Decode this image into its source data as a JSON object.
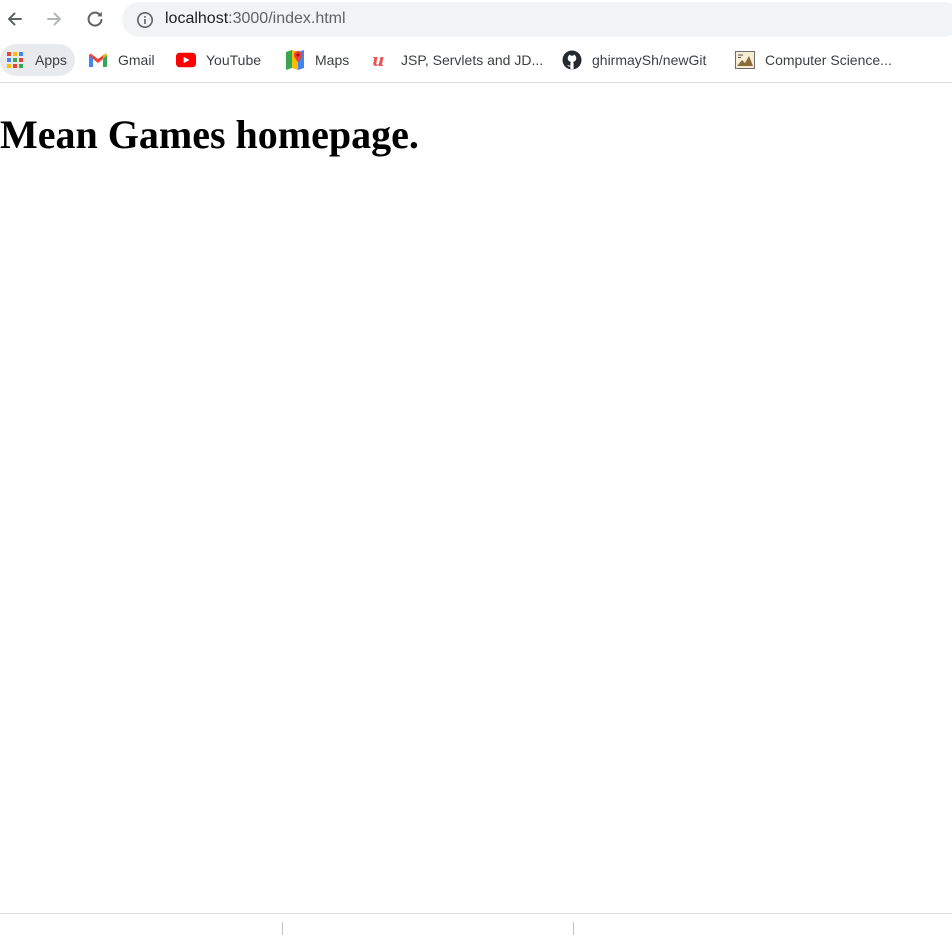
{
  "browser": {
    "address_bar": {
      "url_host": "localhost",
      "url_path": ":3000/index.html"
    },
    "bookmarks": [
      {
        "label": "Apps",
        "icon": "apps-grid-icon"
      },
      {
        "label": "Gmail",
        "icon": "gmail-icon"
      },
      {
        "label": "YouTube",
        "icon": "youtube-icon"
      },
      {
        "label": "Maps",
        "icon": "maps-icon"
      },
      {
        "label": "JSP, Servlets and JD...",
        "icon": "udemy-icon"
      },
      {
        "label": "ghirmaySh/newGit",
        "icon": "github-icon"
      },
      {
        "label": "Computer Science...",
        "icon": "bookmark-image-icon"
      }
    ]
  },
  "page": {
    "heading": "Mean Games homepage."
  },
  "colors": {
    "omnibox_bg": "#f1f3f4",
    "gmail_red": "#ea4335",
    "youtube_red": "#ff0000",
    "udemy_red": "#ec5252",
    "maps_green": "#34a853"
  }
}
